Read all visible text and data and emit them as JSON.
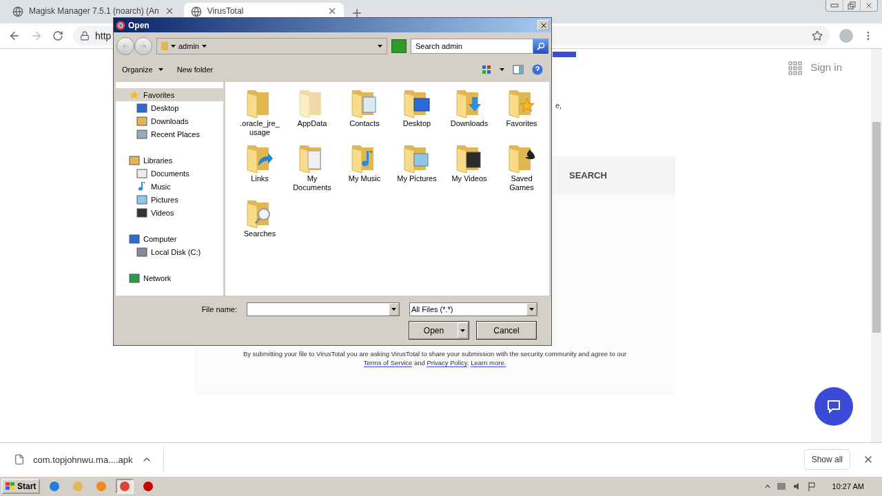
{
  "browser": {
    "tabs": [
      {
        "title": "Magisk Manager 7.5.1 (noarch) (An",
        "selected": false
      },
      {
        "title": "VirusTotal",
        "selected": true
      }
    ],
    "address": "http"
  },
  "page": {
    "sign_in": "Sign in",
    "fragment": "e,",
    "search_tab": "SEARCH",
    "notice": {
      "text": "By submitting your file to VirusTotal you are asking VirusTotal to share your submission with the security community and agree to our",
      "terms": "Terms of Service",
      "and": "and",
      "privacy": "Privacy Policy",
      "period": ".",
      "learn": "Learn more."
    }
  },
  "dialog": {
    "title": "Open",
    "location": "admin",
    "search_placeholder": "Search admin",
    "toolbar": [
      {
        "label": "Organize",
        "kind": "menu"
      },
      {
        "label": "New folder",
        "kind": "button"
      }
    ],
    "nav": [
      {
        "label": "Favorites",
        "kind": "favorites",
        "selected": true,
        "children": [
          {
            "label": "Desktop",
            "kind": "desktop",
            "selected": false
          },
          {
            "label": "Downloads",
            "kind": "downloads",
            "selected": false
          },
          {
            "label": "Recent Places",
            "kind": "recent",
            "selected": false
          }
        ]
      },
      {
        "label": "Libraries",
        "kind": "libraries",
        "selected": false,
        "children": [
          {
            "label": "Documents",
            "kind": "documents",
            "selected": false
          },
          {
            "label": "Music",
            "kind": "music",
            "selected": false
          },
          {
            "label": "Pictures",
            "kind": "pictures",
            "selected": false
          },
          {
            "label": "Videos",
            "kind": "videos",
            "selected": false
          }
        ]
      },
      {
        "label": "Computer",
        "kind": "computer",
        "selected": false,
        "children": [
          {
            "label": "Local Disk (C:)",
            "kind": "disk",
            "selected": false
          }
        ]
      },
      {
        "label": "Network",
        "kind": "network",
        "selected": false
      }
    ],
    "items": [
      {
        "label": ".oracle_jre_usage",
        "kind": "plain"
      },
      {
        "label": "AppData",
        "kind": "hidden"
      },
      {
        "label": "Contacts",
        "kind": "contacts"
      },
      {
        "label": "Desktop",
        "kind": "desktop"
      },
      {
        "label": "Downloads",
        "kind": "downloads"
      },
      {
        "label": "Favorites",
        "kind": "favorites"
      },
      {
        "label": "Links",
        "kind": "links"
      },
      {
        "label": "My Documents",
        "kind": "documents"
      },
      {
        "label": "My Music",
        "kind": "music"
      },
      {
        "label": "My Pictures",
        "kind": "pictures"
      },
      {
        "label": "My Videos",
        "kind": "videos"
      },
      {
        "label": "Saved Games",
        "kind": "games"
      },
      {
        "label": "Searches",
        "kind": "searches"
      }
    ],
    "file_name_label": "File name:",
    "filter": "All Files (*.*)",
    "open": "Open",
    "cancel": "Cancel"
  },
  "downloads": {
    "file": "com.topjohnwu.ma....apk",
    "show_all": "Show all"
  },
  "taskbar": {
    "start": "Start",
    "apps": [
      {
        "kind": "ie",
        "selected": false
      },
      {
        "kind": "explorer",
        "selected": false
      },
      {
        "kind": "media",
        "selected": false
      },
      {
        "kind": "chrome",
        "selected": true
      },
      {
        "kind": "stop",
        "selected": false
      }
    ],
    "time": "10:27 AM"
  }
}
